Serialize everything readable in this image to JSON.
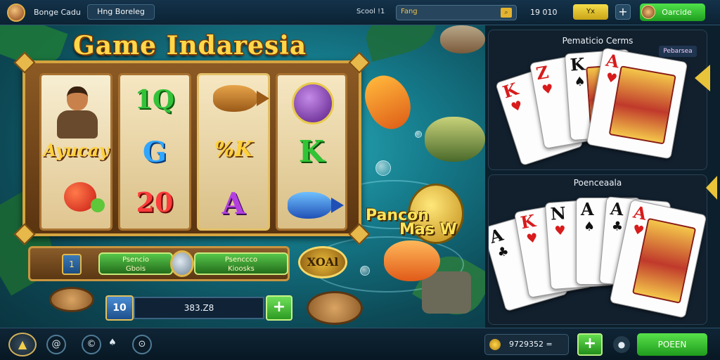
{
  "topbar": {
    "app_title": "Bonge Cadu",
    "user_name": "Hng Boreleg",
    "search_label": "Scool !1",
    "search_value": "Fang",
    "balance": "19 010",
    "yellow_button": "Yx",
    "plus": "+",
    "deposit_label": "Oarcide"
  },
  "game": {
    "title": "Game Indaresia",
    "reels": {
      "reel1_mid": "Ayucay",
      "reel2": [
        "1Q",
        "G",
        "20"
      ],
      "reel3": [
        "%K",
        "A"
      ],
      "reel4": [
        "K"
      ]
    },
    "controls": {
      "bet_icon": "1",
      "left_pill": [
        "Psencio",
        "Gbois"
      ],
      "right_pill": [
        "Psenccco",
        "Kioosks"
      ],
      "auto_label": "XOAl",
      "bet_chip": "10",
      "bet_amount": "383.Z8",
      "plus": "+"
    },
    "badge_text": [
      "Pancon",
      "Mas W"
    ]
  },
  "right_panel": {
    "top_title": "Pematicio Cerms",
    "top_sub": "Pebarsea",
    "bottom_title": "Poenceaala",
    "top_cards": [
      {
        "rank": "K",
        "suit": "♥"
      },
      {
        "rank": "Z",
        "suit": "♥"
      },
      {
        "rank": "K",
        "suit": "♠"
      },
      {
        "rank": "A",
        "suit": "♥"
      }
    ],
    "bottom_cards": [
      {
        "rank": "A",
        "suit": "♣"
      },
      {
        "rank": "K",
        "suit": "♥"
      },
      {
        "rank": "N",
        "suit": "♥"
      },
      {
        "rank": "A",
        "suit": "♠"
      },
      {
        "rank": "A",
        "suit": "♣"
      },
      {
        "rank": "A",
        "suit": "♥"
      }
    ]
  },
  "bottombar": {
    "home_icon": "▲",
    "nav": [
      "@",
      "©",
      "♠",
      "⊙"
    ],
    "wallet_value": "9729352 =",
    "plus": "+",
    "small_icon": "●",
    "open_label": "POEEN"
  },
  "colors": {
    "accent_green": "#3ec93a",
    "accent_gold": "#e9c43a",
    "panel_bg": "#12202e"
  }
}
